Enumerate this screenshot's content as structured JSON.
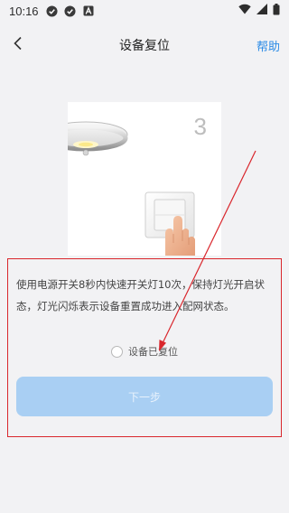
{
  "status_bar": {
    "time": "10:16",
    "icons": [
      "check-circle-icon",
      "check-circle-icon",
      "notification-a-icon"
    ],
    "right_icons": [
      "wifi-icon",
      "signal-icon",
      "battery-icon"
    ]
  },
  "header": {
    "title": "设备复位",
    "help_label": "帮助",
    "back_icon": "chevron-left-icon"
  },
  "illustration": {
    "step_number": "3"
  },
  "instruction": {
    "text": "使用电源开关8秒内快速开关灯10次，保持灯光开启状态，灯光闪烁表示设备重置成功进入配网状态。"
  },
  "reset_check": {
    "label": "设备已复位",
    "checked": false
  },
  "next_button": {
    "label": "下一步",
    "enabled": false
  },
  "colors": {
    "accent": "#2b8be6",
    "button_disabled": "#a9cff3",
    "annotation": "#d9262c",
    "background": "#f2f2f4"
  }
}
